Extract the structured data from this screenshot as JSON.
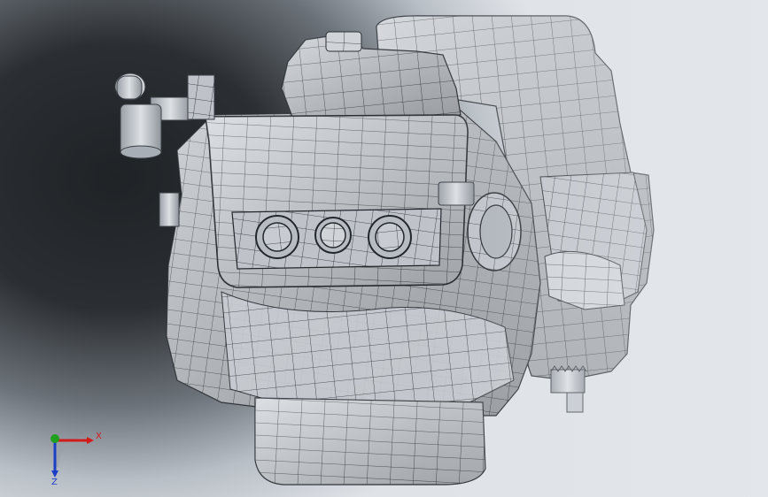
{
  "viewport": {
    "background_dark": "#24282c",
    "background_light": "#e2e6ea"
  },
  "model": {
    "surface_color": "#c4c8ce",
    "mesh_color": "#1c1f24"
  },
  "triad": {
    "x_label": "X",
    "z_label": "Z",
    "x_color": "#d11a1a",
    "y_color": "#1fa01f",
    "z_color": "#1a3fc4"
  }
}
